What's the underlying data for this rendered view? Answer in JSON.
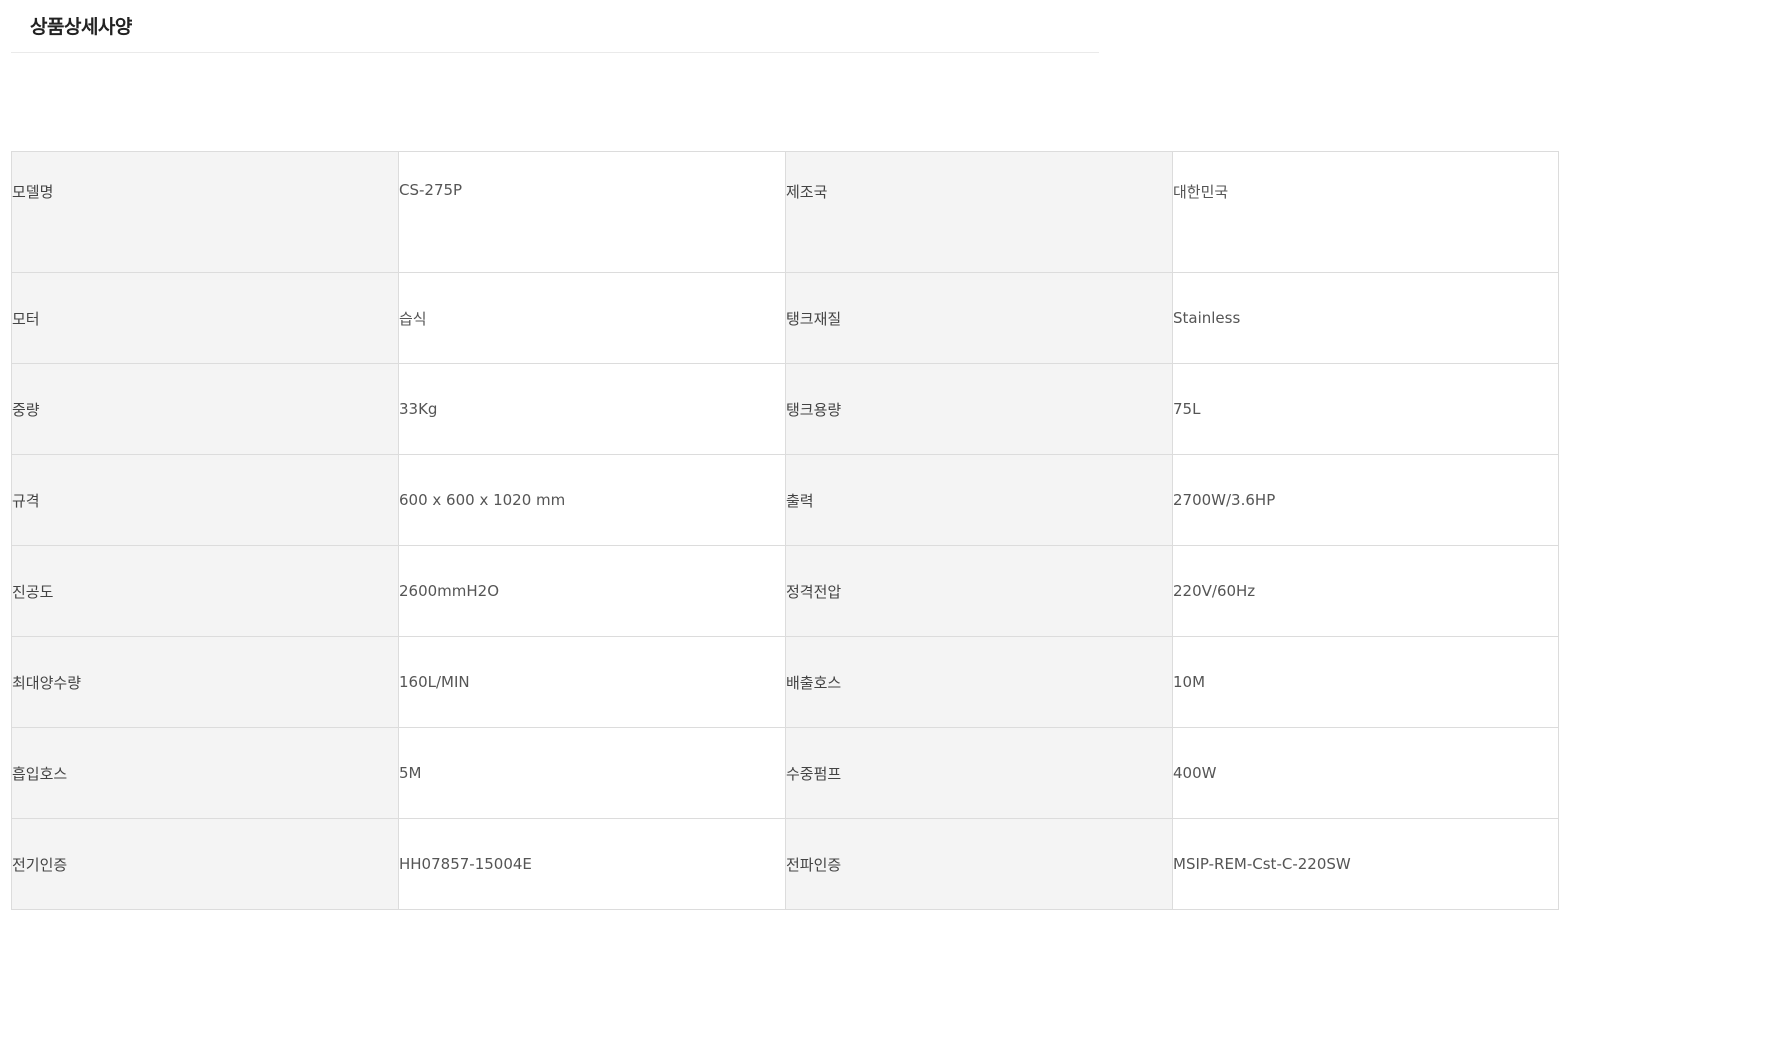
{
  "section": {
    "title": "상품상세사양"
  },
  "specs": [
    {
      "label1": "모델명",
      "value1": "CS-275P",
      "label2": "제조국",
      "value2": "대한민국"
    },
    {
      "label1": "모터",
      "value1": "습식",
      "label2": "탱크재질",
      "value2": "Stainless"
    },
    {
      "label1": "중량",
      "value1": "33Kg",
      "label2": "탱크용량",
      "value2": "75L"
    },
    {
      "label1": "규격",
      "value1": "600 x 600 x 1020 mm",
      "label2": "출력",
      "value2": "2700W/3.6HP"
    },
    {
      "label1": "진공도",
      "value1": "2600mmH2O",
      "label2": "정격전압",
      "value2": "220V/60Hz"
    },
    {
      "label1": "최대양수량",
      "value1": "160L/MIN",
      "label2": "배출호스",
      "value2": "10M"
    },
    {
      "label1": "흡입호스",
      "value1": "5M",
      "label2": "수중펌프",
      "value2": "400W"
    },
    {
      "label1": "전기인증",
      "value1": "HH07857-15004E",
      "label2": "전파인증",
      "value2": "MSIP-REM-Cst-C-220SW"
    }
  ]
}
